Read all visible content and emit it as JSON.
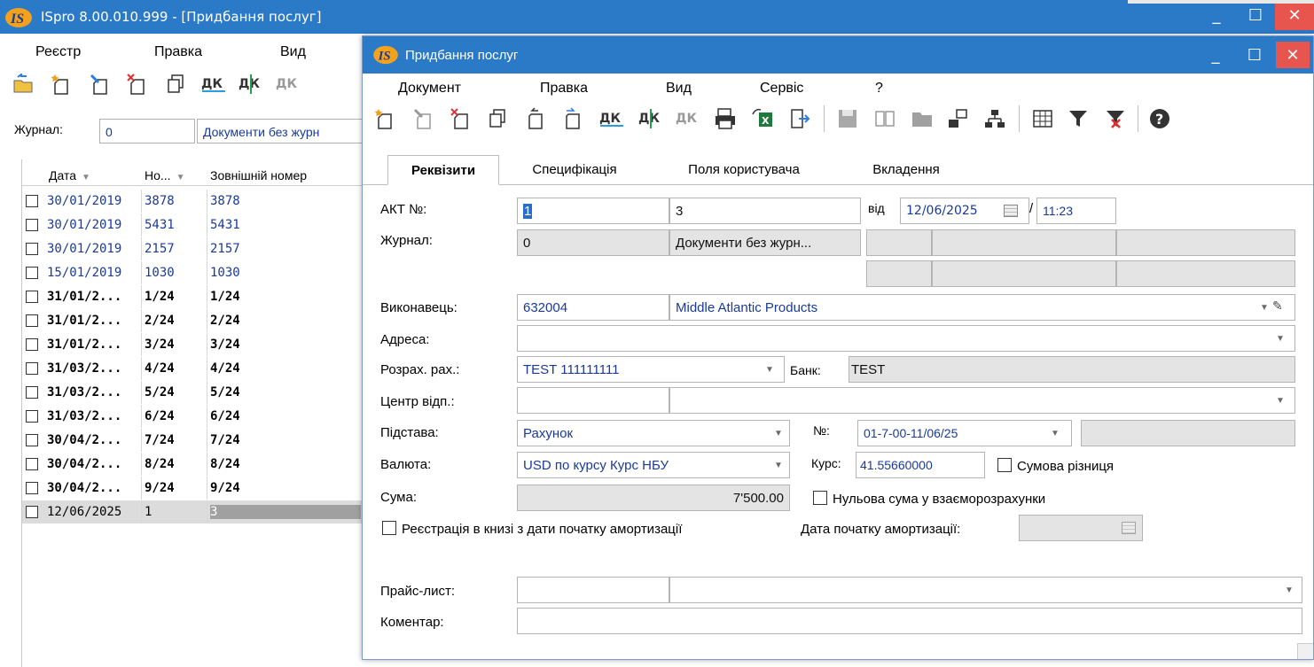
{
  "main": {
    "title": "ISpro 8.00.010.999 - [Придбання послуг]",
    "menu": [
      "Реєстр",
      "Правка",
      "Вид"
    ],
    "journal_label": "Журнал:",
    "journal_code": "0",
    "journal_name": "Документи без журн",
    "columns": [
      "Дата",
      "Но...",
      "Зовнішній номер"
    ],
    "rows": [
      {
        "date": "30/01/2019",
        "num": "3878",
        "ext": "3878",
        "style": "normal"
      },
      {
        "date": "30/01/2019",
        "num": "5431",
        "ext": "5431",
        "style": "normal"
      },
      {
        "date": "30/01/2019",
        "num": "2157",
        "ext": "2157",
        "style": "normal"
      },
      {
        "date": "15/01/2019",
        "num": "1030",
        "ext": "1030",
        "style": "normal"
      },
      {
        "date": "31/01/2...",
        "num": "1/24",
        "ext": "1/24",
        "style": "bold"
      },
      {
        "date": "31/01/2...",
        "num": "2/24",
        "ext": "2/24",
        "style": "bold"
      },
      {
        "date": "31/01/2...",
        "num": "3/24",
        "ext": "3/24",
        "style": "bold"
      },
      {
        "date": "31/03/2...",
        "num": "4/24",
        "ext": "4/24",
        "style": "bold"
      },
      {
        "date": "31/03/2...",
        "num": "5/24",
        "ext": "5/24",
        "style": "bold"
      },
      {
        "date": "31/03/2...",
        "num": "6/24",
        "ext": "6/24",
        "style": "bold"
      },
      {
        "date": "30/04/2...",
        "num": "7/24",
        "ext": "7/24",
        "style": "bold"
      },
      {
        "date": "30/04/2...",
        "num": "8/24",
        "ext": "8/24",
        "style": "bold"
      },
      {
        "date": "30/04/2...",
        "num": "9/24",
        "ext": "9/24",
        "style": "bold"
      },
      {
        "date": "12/06/2025",
        "num": "1",
        "ext": "3",
        "style": "selected"
      }
    ]
  },
  "dialog": {
    "title": "Придбання послуг",
    "menu": [
      "Документ",
      "Правка",
      "Вид",
      "Сервіс",
      "?"
    ],
    "tabs": [
      "Реквізити",
      "Специфікація",
      "Поля користувача",
      "Вкладення"
    ],
    "active_tab": "Реквізити",
    "act_label": "АКТ №:",
    "act_number": "1",
    "act_ext_number": "3",
    "from_label": "від",
    "date": "12/06/2025",
    "date_sep": "/",
    "time": "11:23",
    "journal_label": "Журнал:",
    "journal_code": "0",
    "journal_name": "Документи без журн...",
    "executor_label": "Виконавець:",
    "executor_code": "632004",
    "executor_name": "Middle Atlantic Products",
    "address_label": "Адреса:",
    "account_label": "Розрах. рах.:",
    "account_value": "TEST 111111111",
    "bank_label": "Банк:",
    "bank_value": "TEST",
    "center_label": "Центр відп.:",
    "basis_label": "Підстава:",
    "basis_value": "Рахунок",
    "number_label": "№:",
    "number_value": "01-7-00-11/06/25",
    "currency_label": "Валюта:",
    "currency_value": "USD по курсу Курс НБУ",
    "rate_label": "Курс:",
    "rate_value": "41.55660000",
    "sum_diff_label": "Сумова різниця",
    "sum_label": "Сума:",
    "sum_value": "7'500.00",
    "zero_sum_label": "Нульова сума у взаєморозрахунки",
    "register_label": "Реєстрація в книзі з дати початку амортизації",
    "amort_date_label": "Дата початку амортизації:",
    "price_list_label": "Прайс-лист:",
    "comment_label": "Коментар:"
  },
  "colors": {
    "titlebar": "#2b7ac7",
    "close_button": "#e8554e",
    "link_text": "#1a3a9a",
    "readonly_bg": "#e4e4e4",
    "selection": "#dcdcdc"
  }
}
